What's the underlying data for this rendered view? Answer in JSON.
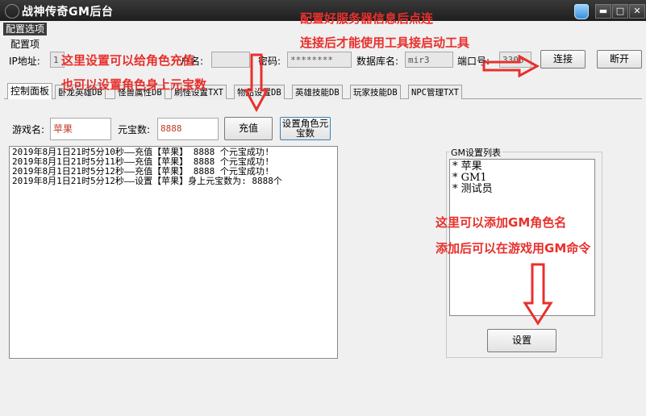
{
  "window": {
    "title": "战神传奇GM后台",
    "btn_min": "▬",
    "btn_max": "□",
    "btn_close": "✕"
  },
  "menu": {
    "config": "配置选项"
  },
  "config": {
    "group_label": "配置项",
    "ip_label": "IP地址:",
    "ip_value": "1",
    "user_label": "户名:",
    "password_label": "密码:",
    "password_value": "********",
    "db_label": "数据库名:",
    "db_value": "mir3",
    "port_label": "端口号:",
    "port_value": "3306",
    "connect_button": "连接",
    "disconnect_button": "断开"
  },
  "tabs": [
    {
      "label": "控制面板"
    },
    {
      "label": "卧龙英雄DB"
    },
    {
      "label": "怪兽属性DB"
    },
    {
      "label": "刷怪设置TXT"
    },
    {
      "label": "物品设置DB"
    },
    {
      "label": "英雄技能DB"
    },
    {
      "label": "玩家技能DB"
    },
    {
      "label": "NPC管理TXT"
    }
  ],
  "control": {
    "game_name_label": "游戏名:",
    "game_name_value": "苹果",
    "ingot_label": "元宝数:",
    "ingot_value": "8888",
    "recharge_button": "充值",
    "set_ingot_button_line1": "设置角色元",
    "set_ingot_button_line2": "宝数"
  },
  "log": [
    "2019年8月1日21时5分10秒——充值【苹果】 8888 个元宝成功!",
    "2019年8月1日21时5分11秒——充值【苹果】 8888 个元宝成功!",
    "2019年8月1日21时5分12秒——充值【苹果】 8888 个元宝成功!",
    "2019年8月1日21时5分12秒——设置【苹果】身上元宝数为: 8888个"
  ],
  "gm": {
    "group_title": "GM设置列表",
    "items": [
      "* 苹果",
      "* GM1",
      "* 测试员"
    ],
    "set_button": "设置"
  },
  "annotations": {
    "top_right_1": "配置好服务器信息后点连",
    "top_right_2": "连接后才能使用工具接启动工具",
    "left_1": "这里设置可以给角色充值",
    "left_2": "也可以设置角色身上元宝数",
    "right_1": "这里可以添加GM角色名",
    "right_2": "添加后可以在游戏用GM命令"
  },
  "colors": {
    "annotation": "#e8302c",
    "titlebar": "#262626",
    "input_text": "#c0392b"
  }
}
